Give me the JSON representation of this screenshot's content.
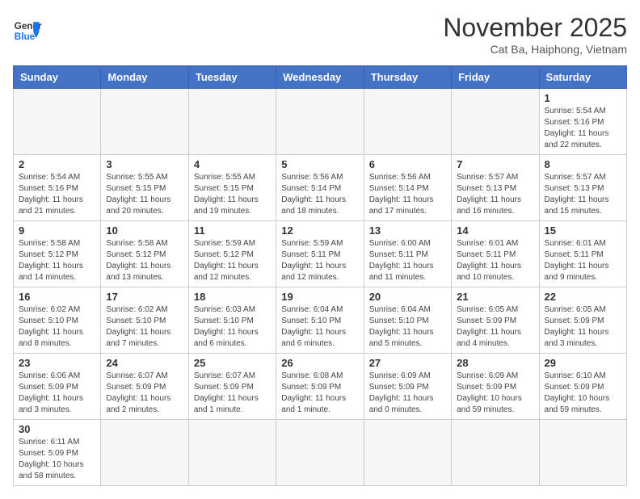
{
  "logo": {
    "line1": "General",
    "line2": "Blue"
  },
  "title": "November 2025",
  "location": "Cat Ba, Haiphong, Vietnam",
  "days_of_week": [
    "Sunday",
    "Monday",
    "Tuesday",
    "Wednesday",
    "Thursday",
    "Friday",
    "Saturday"
  ],
  "weeks": [
    [
      {
        "day": "",
        "info": ""
      },
      {
        "day": "",
        "info": ""
      },
      {
        "day": "",
        "info": ""
      },
      {
        "day": "",
        "info": ""
      },
      {
        "day": "",
        "info": ""
      },
      {
        "day": "",
        "info": ""
      },
      {
        "day": "1",
        "info": "Sunrise: 5:54 AM\nSunset: 5:16 PM\nDaylight: 11 hours and 22 minutes."
      }
    ],
    [
      {
        "day": "2",
        "info": "Sunrise: 5:54 AM\nSunset: 5:16 PM\nDaylight: 11 hours and 21 minutes."
      },
      {
        "day": "3",
        "info": "Sunrise: 5:55 AM\nSunset: 5:15 PM\nDaylight: 11 hours and 20 minutes."
      },
      {
        "day": "4",
        "info": "Sunrise: 5:55 AM\nSunset: 5:15 PM\nDaylight: 11 hours and 19 minutes."
      },
      {
        "day": "5",
        "info": "Sunrise: 5:56 AM\nSunset: 5:14 PM\nDaylight: 11 hours and 18 minutes."
      },
      {
        "day": "6",
        "info": "Sunrise: 5:56 AM\nSunset: 5:14 PM\nDaylight: 11 hours and 17 minutes."
      },
      {
        "day": "7",
        "info": "Sunrise: 5:57 AM\nSunset: 5:13 PM\nDaylight: 11 hours and 16 minutes."
      },
      {
        "day": "8",
        "info": "Sunrise: 5:57 AM\nSunset: 5:13 PM\nDaylight: 11 hours and 15 minutes."
      }
    ],
    [
      {
        "day": "9",
        "info": "Sunrise: 5:58 AM\nSunset: 5:12 PM\nDaylight: 11 hours and 14 minutes."
      },
      {
        "day": "10",
        "info": "Sunrise: 5:58 AM\nSunset: 5:12 PM\nDaylight: 11 hours and 13 minutes."
      },
      {
        "day": "11",
        "info": "Sunrise: 5:59 AM\nSunset: 5:12 PM\nDaylight: 11 hours and 12 minutes."
      },
      {
        "day": "12",
        "info": "Sunrise: 5:59 AM\nSunset: 5:11 PM\nDaylight: 11 hours and 12 minutes."
      },
      {
        "day": "13",
        "info": "Sunrise: 6:00 AM\nSunset: 5:11 PM\nDaylight: 11 hours and 11 minutes."
      },
      {
        "day": "14",
        "info": "Sunrise: 6:01 AM\nSunset: 5:11 PM\nDaylight: 11 hours and 10 minutes."
      },
      {
        "day": "15",
        "info": "Sunrise: 6:01 AM\nSunset: 5:11 PM\nDaylight: 11 hours and 9 minutes."
      }
    ],
    [
      {
        "day": "16",
        "info": "Sunrise: 6:02 AM\nSunset: 5:10 PM\nDaylight: 11 hours and 8 minutes."
      },
      {
        "day": "17",
        "info": "Sunrise: 6:02 AM\nSunset: 5:10 PM\nDaylight: 11 hours and 7 minutes."
      },
      {
        "day": "18",
        "info": "Sunrise: 6:03 AM\nSunset: 5:10 PM\nDaylight: 11 hours and 6 minutes."
      },
      {
        "day": "19",
        "info": "Sunrise: 6:04 AM\nSunset: 5:10 PM\nDaylight: 11 hours and 6 minutes."
      },
      {
        "day": "20",
        "info": "Sunrise: 6:04 AM\nSunset: 5:10 PM\nDaylight: 11 hours and 5 minutes."
      },
      {
        "day": "21",
        "info": "Sunrise: 6:05 AM\nSunset: 5:09 PM\nDaylight: 11 hours and 4 minutes."
      },
      {
        "day": "22",
        "info": "Sunrise: 6:05 AM\nSunset: 5:09 PM\nDaylight: 11 hours and 3 minutes."
      }
    ],
    [
      {
        "day": "23",
        "info": "Sunrise: 6:06 AM\nSunset: 5:09 PM\nDaylight: 11 hours and 3 minutes."
      },
      {
        "day": "24",
        "info": "Sunrise: 6:07 AM\nSunset: 5:09 PM\nDaylight: 11 hours and 2 minutes."
      },
      {
        "day": "25",
        "info": "Sunrise: 6:07 AM\nSunset: 5:09 PM\nDaylight: 11 hours and 1 minute."
      },
      {
        "day": "26",
        "info": "Sunrise: 6:08 AM\nSunset: 5:09 PM\nDaylight: 11 hours and 1 minute."
      },
      {
        "day": "27",
        "info": "Sunrise: 6:09 AM\nSunset: 5:09 PM\nDaylight: 11 hours and 0 minutes."
      },
      {
        "day": "28",
        "info": "Sunrise: 6:09 AM\nSunset: 5:09 PM\nDaylight: 10 hours and 59 minutes."
      },
      {
        "day": "29",
        "info": "Sunrise: 6:10 AM\nSunset: 5:09 PM\nDaylight: 10 hours and 59 minutes."
      }
    ],
    [
      {
        "day": "30",
        "info": "Sunrise: 6:11 AM\nSunset: 5:09 PM\nDaylight: 10 hours and 58 minutes."
      },
      {
        "day": "",
        "info": ""
      },
      {
        "day": "",
        "info": ""
      },
      {
        "day": "",
        "info": ""
      },
      {
        "day": "",
        "info": ""
      },
      {
        "day": "",
        "info": ""
      },
      {
        "day": "",
        "info": ""
      }
    ]
  ]
}
